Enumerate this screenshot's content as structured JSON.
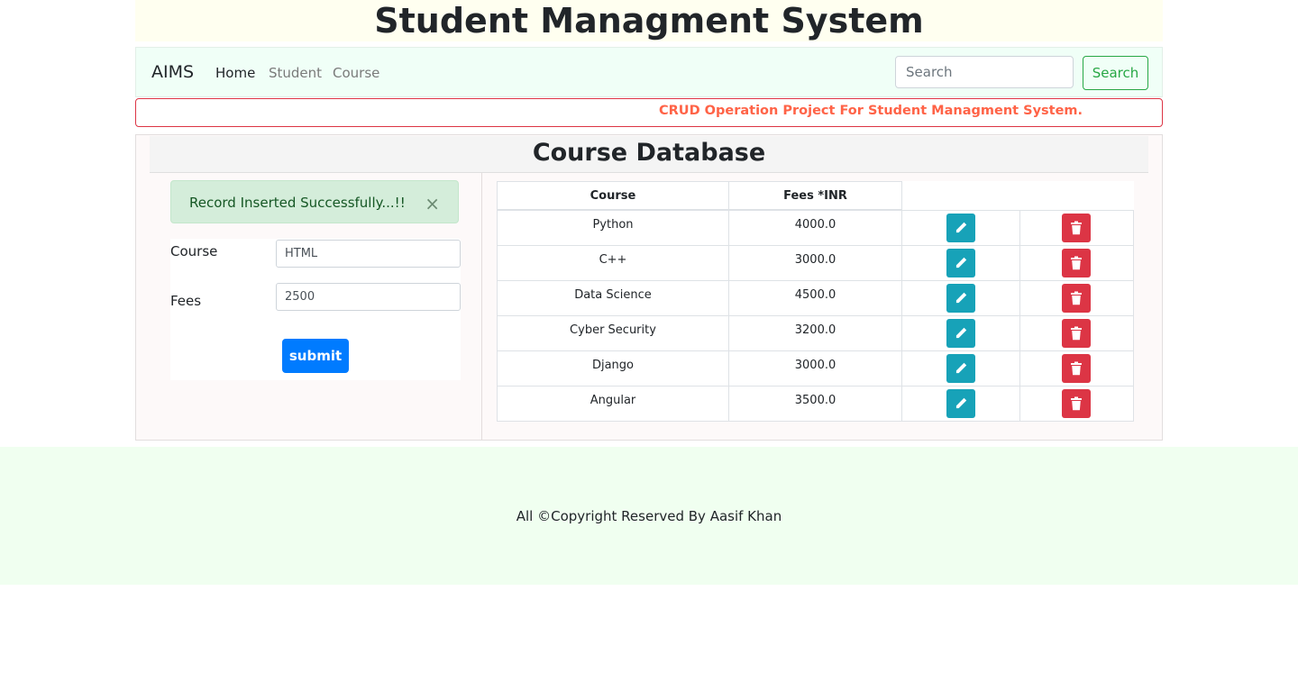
{
  "header": {
    "title": "Student Managment System"
  },
  "navbar": {
    "brand": "AIMS",
    "links": [
      {
        "label": "Home",
        "active": true
      },
      {
        "label": "Student",
        "active": false
      },
      {
        "label": "Course",
        "active": false
      }
    ],
    "search": {
      "placeholder": "Search",
      "button_label": "Search"
    }
  },
  "marquee": {
    "text": "CRUD Operation Project For Student Managment System."
  },
  "panel": {
    "title": "Course Database"
  },
  "alert": {
    "message": "Record Inserted Successfully...!!",
    "close_glyph": "×"
  },
  "form": {
    "course_label": "Course",
    "course_value": "HTML",
    "fees_label": "Fees",
    "fees_value": "2500",
    "submit_label": "submit"
  },
  "table": {
    "headers": [
      "Course",
      "Fees *INR"
    ],
    "rows": [
      {
        "course": "Python",
        "fees": "4000.0"
      },
      {
        "course": "C++",
        "fees": "3000.0"
      },
      {
        "course": "Data Science",
        "fees": "4500.0"
      },
      {
        "course": "Cyber Security",
        "fees": "3200.0"
      },
      {
        "course": "Django",
        "fees": "3000.0"
      },
      {
        "course": "Angular",
        "fees": "3500.0"
      }
    ],
    "edit_icon": "pencil-icon",
    "delete_icon": "trash-icon"
  },
  "footer": {
    "text": "All ©Copyright Reserved By Aasif Khan"
  },
  "colors": {
    "primary": "#007bff",
    "success": "#28a745",
    "danger": "#dc3545",
    "info": "#17a2b8",
    "marquee_text": "#ff6347"
  }
}
